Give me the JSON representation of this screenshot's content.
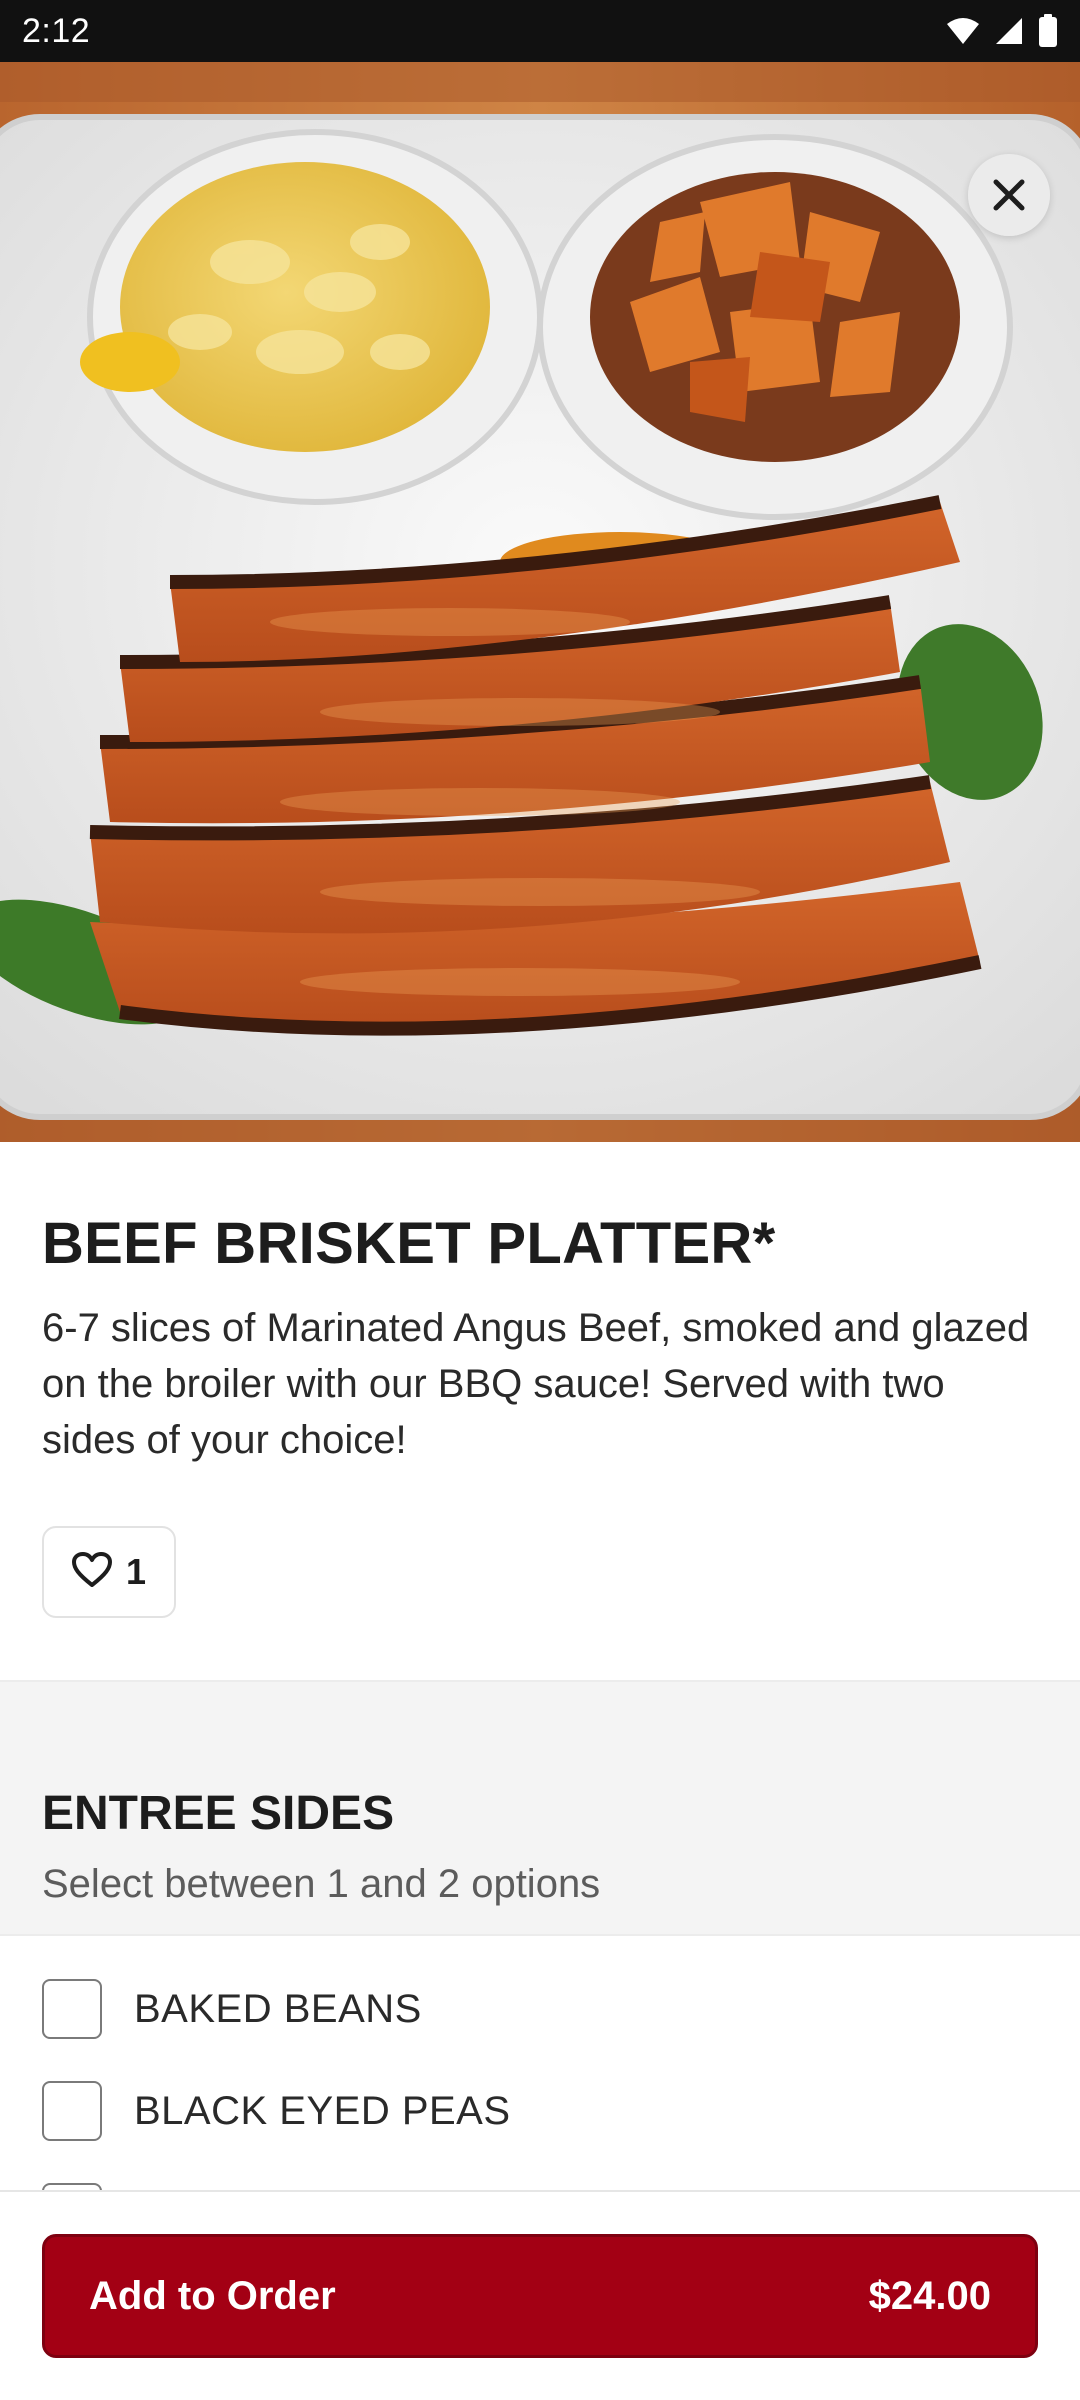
{
  "status_bar": {
    "time": "2:12",
    "icons": [
      "wifi-icon",
      "signal-icon",
      "battery-icon"
    ]
  },
  "hero": {
    "image": "beef-brisket-platter-photo",
    "close_icon": "close-icon"
  },
  "item": {
    "title": "BEEF BRISKET PLATTER*",
    "description": "6-7 slices of Marinated Angus Beef, smoked and glazed on the broiler with our BBQ sauce! Served with two sides of your choice!",
    "favorite_icon": "heart-icon",
    "favorite_count": "1"
  },
  "modifier_group": {
    "title": "ENTREE SIDES",
    "subtitle": "Select between 1 and 2 options",
    "options": [
      {
        "label": "BAKED BEANS",
        "checked": false
      },
      {
        "label": "BLACK EYED PEAS",
        "checked": false
      },
      {
        "label": "",
        "checked": false
      }
    ]
  },
  "order_button": {
    "label": "Add to Order",
    "price": "$24.00"
  },
  "colors": {
    "accent": "#a30014",
    "status_bar": "#111111",
    "section_bg": "#f4f4f4"
  }
}
